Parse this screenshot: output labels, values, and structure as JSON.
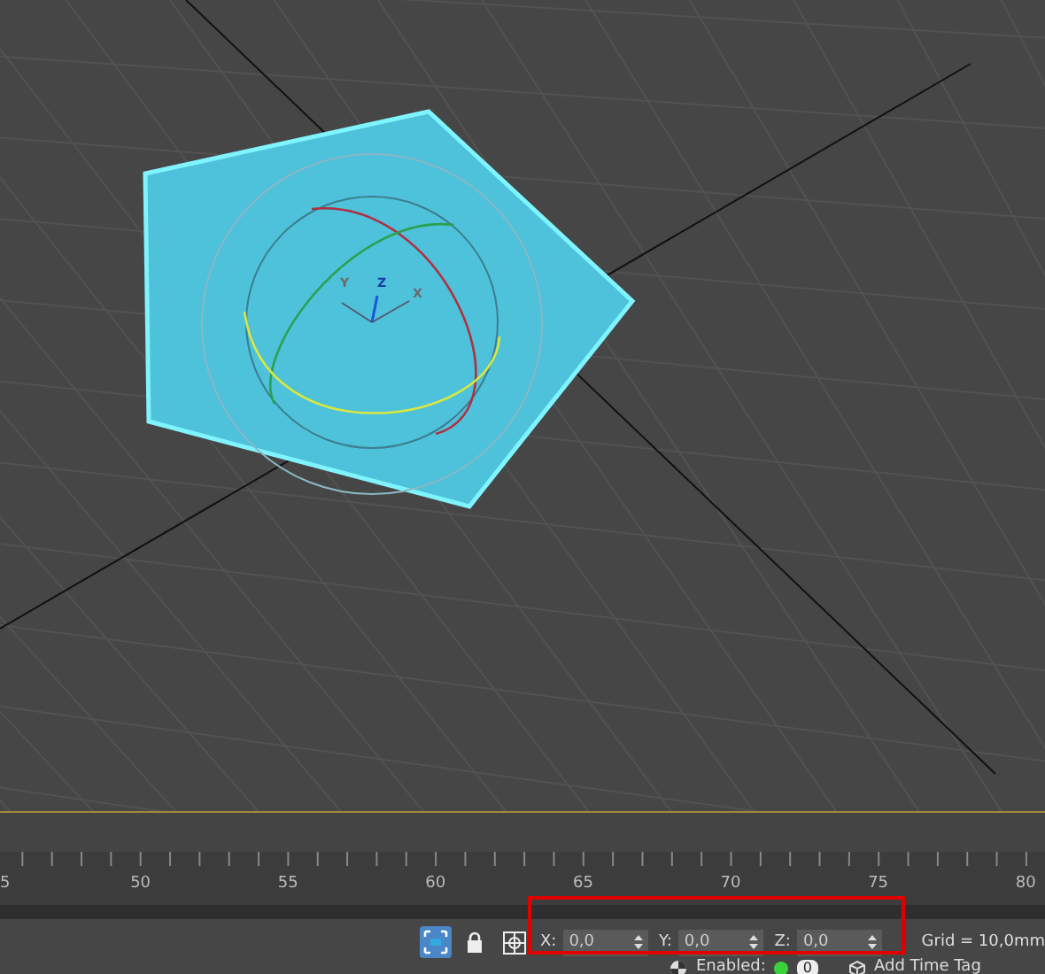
{
  "viewport": {
    "gizmo_labels": [
      "Y",
      "Z",
      "X"
    ]
  },
  "timeline": {
    "labels": [
      "5",
      "50",
      "55",
      "60",
      "65",
      "70",
      "75",
      "80"
    ]
  },
  "status_bar": {
    "selection_lock": {
      "on": true
    },
    "coordinates": [
      {
        "label": "X:",
        "value": "0,0"
      },
      {
        "label": "Y:",
        "value": "0,0"
      },
      {
        "label": "Z:",
        "value": "0,0"
      }
    ],
    "grid": "Grid = 10,0mm",
    "key_mode": {
      "label": "Enabled:",
      "enabled": true,
      "count": "0"
    },
    "time_tag": "Add Time Tag"
  }
}
